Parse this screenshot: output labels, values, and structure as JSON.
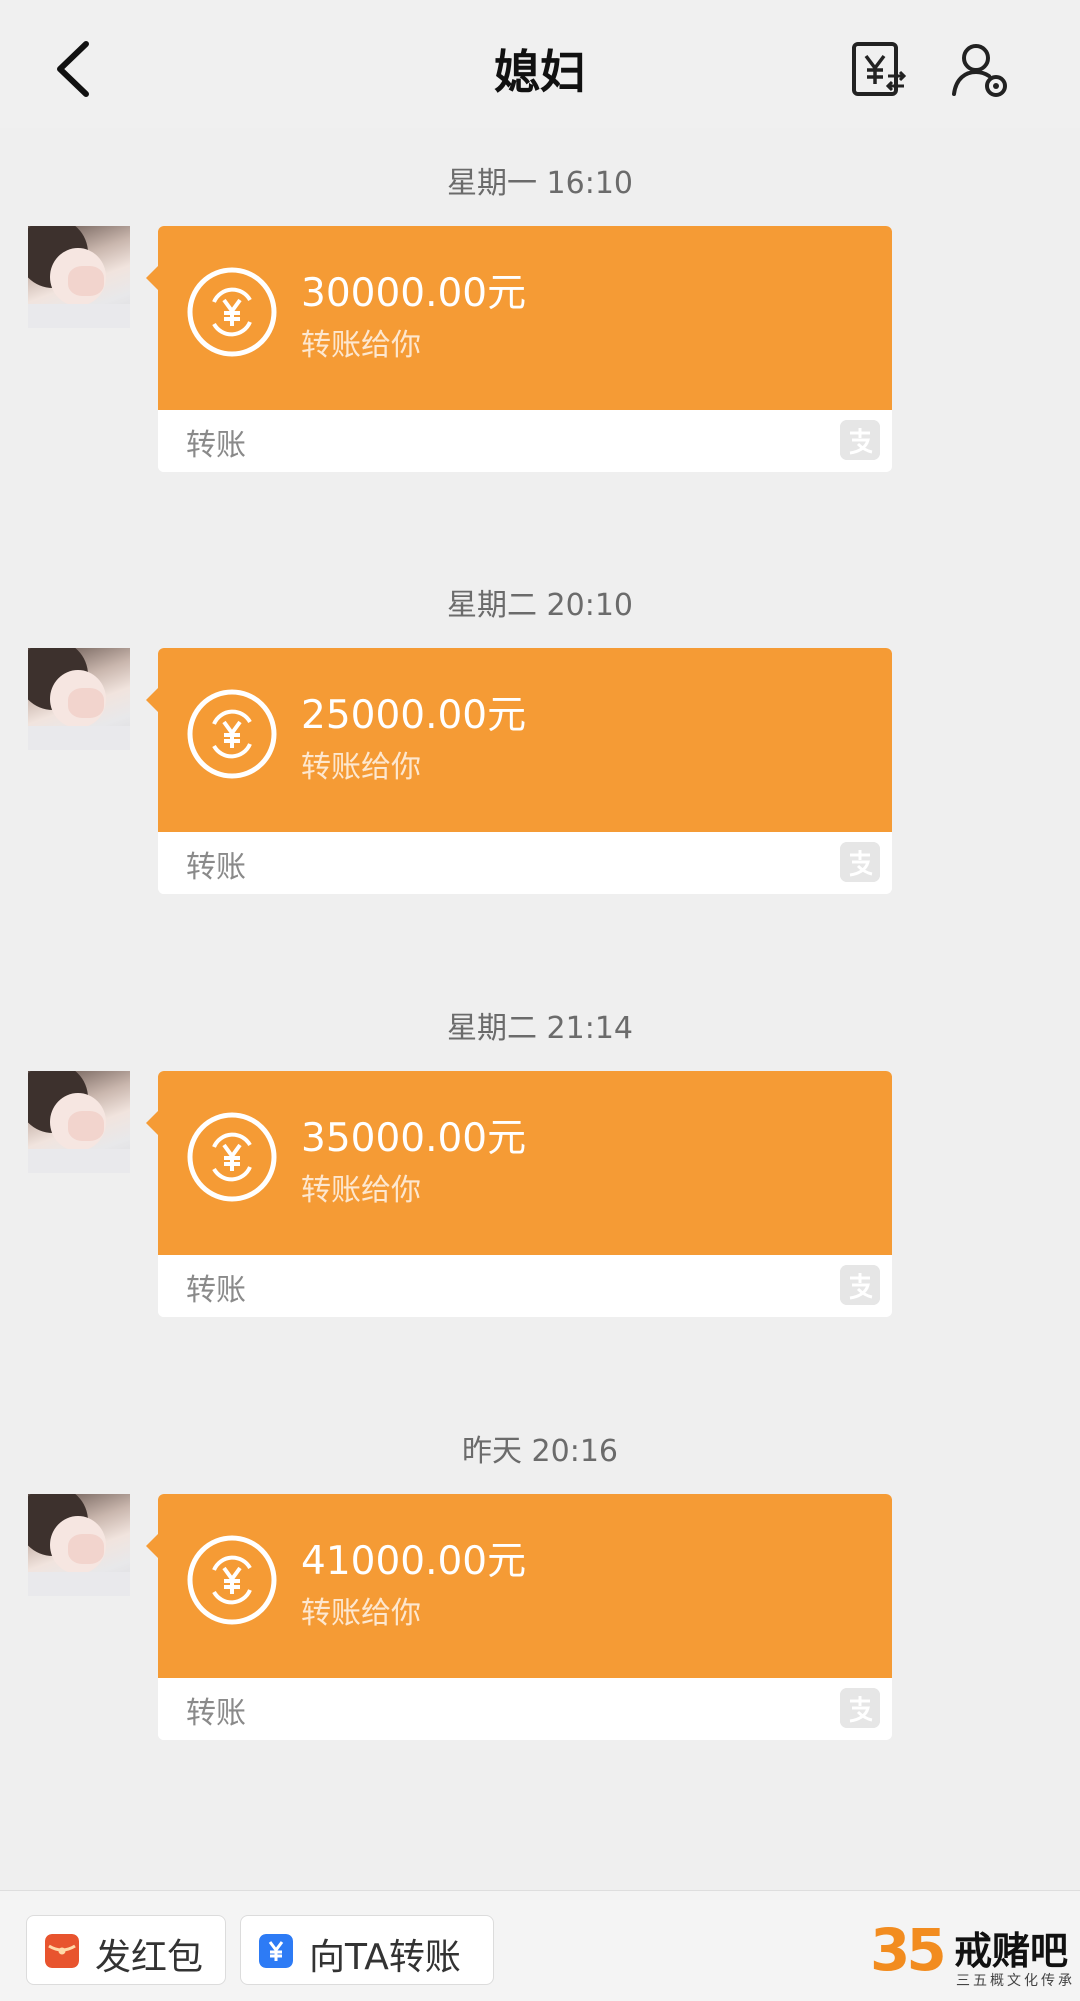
{
  "header": {
    "title": "媳妇",
    "back_icon": "chevron-left-icon",
    "bill_icon": "yuan-bill-icon",
    "profile_icon": "user-settings-icon"
  },
  "colors": {
    "accent": "#f59b35",
    "background": "#efefef"
  },
  "messages": [
    {
      "time": "星期一 16:10",
      "amount": "30000.00元",
      "subtitle": "转账给你",
      "label": "转账"
    },
    {
      "time": "星期二 20:10",
      "amount": "25000.00元",
      "subtitle": "转账给你",
      "label": "转账"
    },
    {
      "time": "星期二 21:14",
      "amount": "35000.00元",
      "subtitle": "转账给你",
      "label": "转账"
    },
    {
      "time": "昨天 20:16",
      "amount": "41000.00元",
      "subtitle": "转账给你",
      "label": "转账"
    }
  ],
  "bottom_bar": {
    "red_packet_label": "发红包",
    "transfer_label": "向TA转账"
  },
  "watermark": {
    "number": "35",
    "name": "戒赌吧",
    "tagline": "三五概文化传承"
  }
}
